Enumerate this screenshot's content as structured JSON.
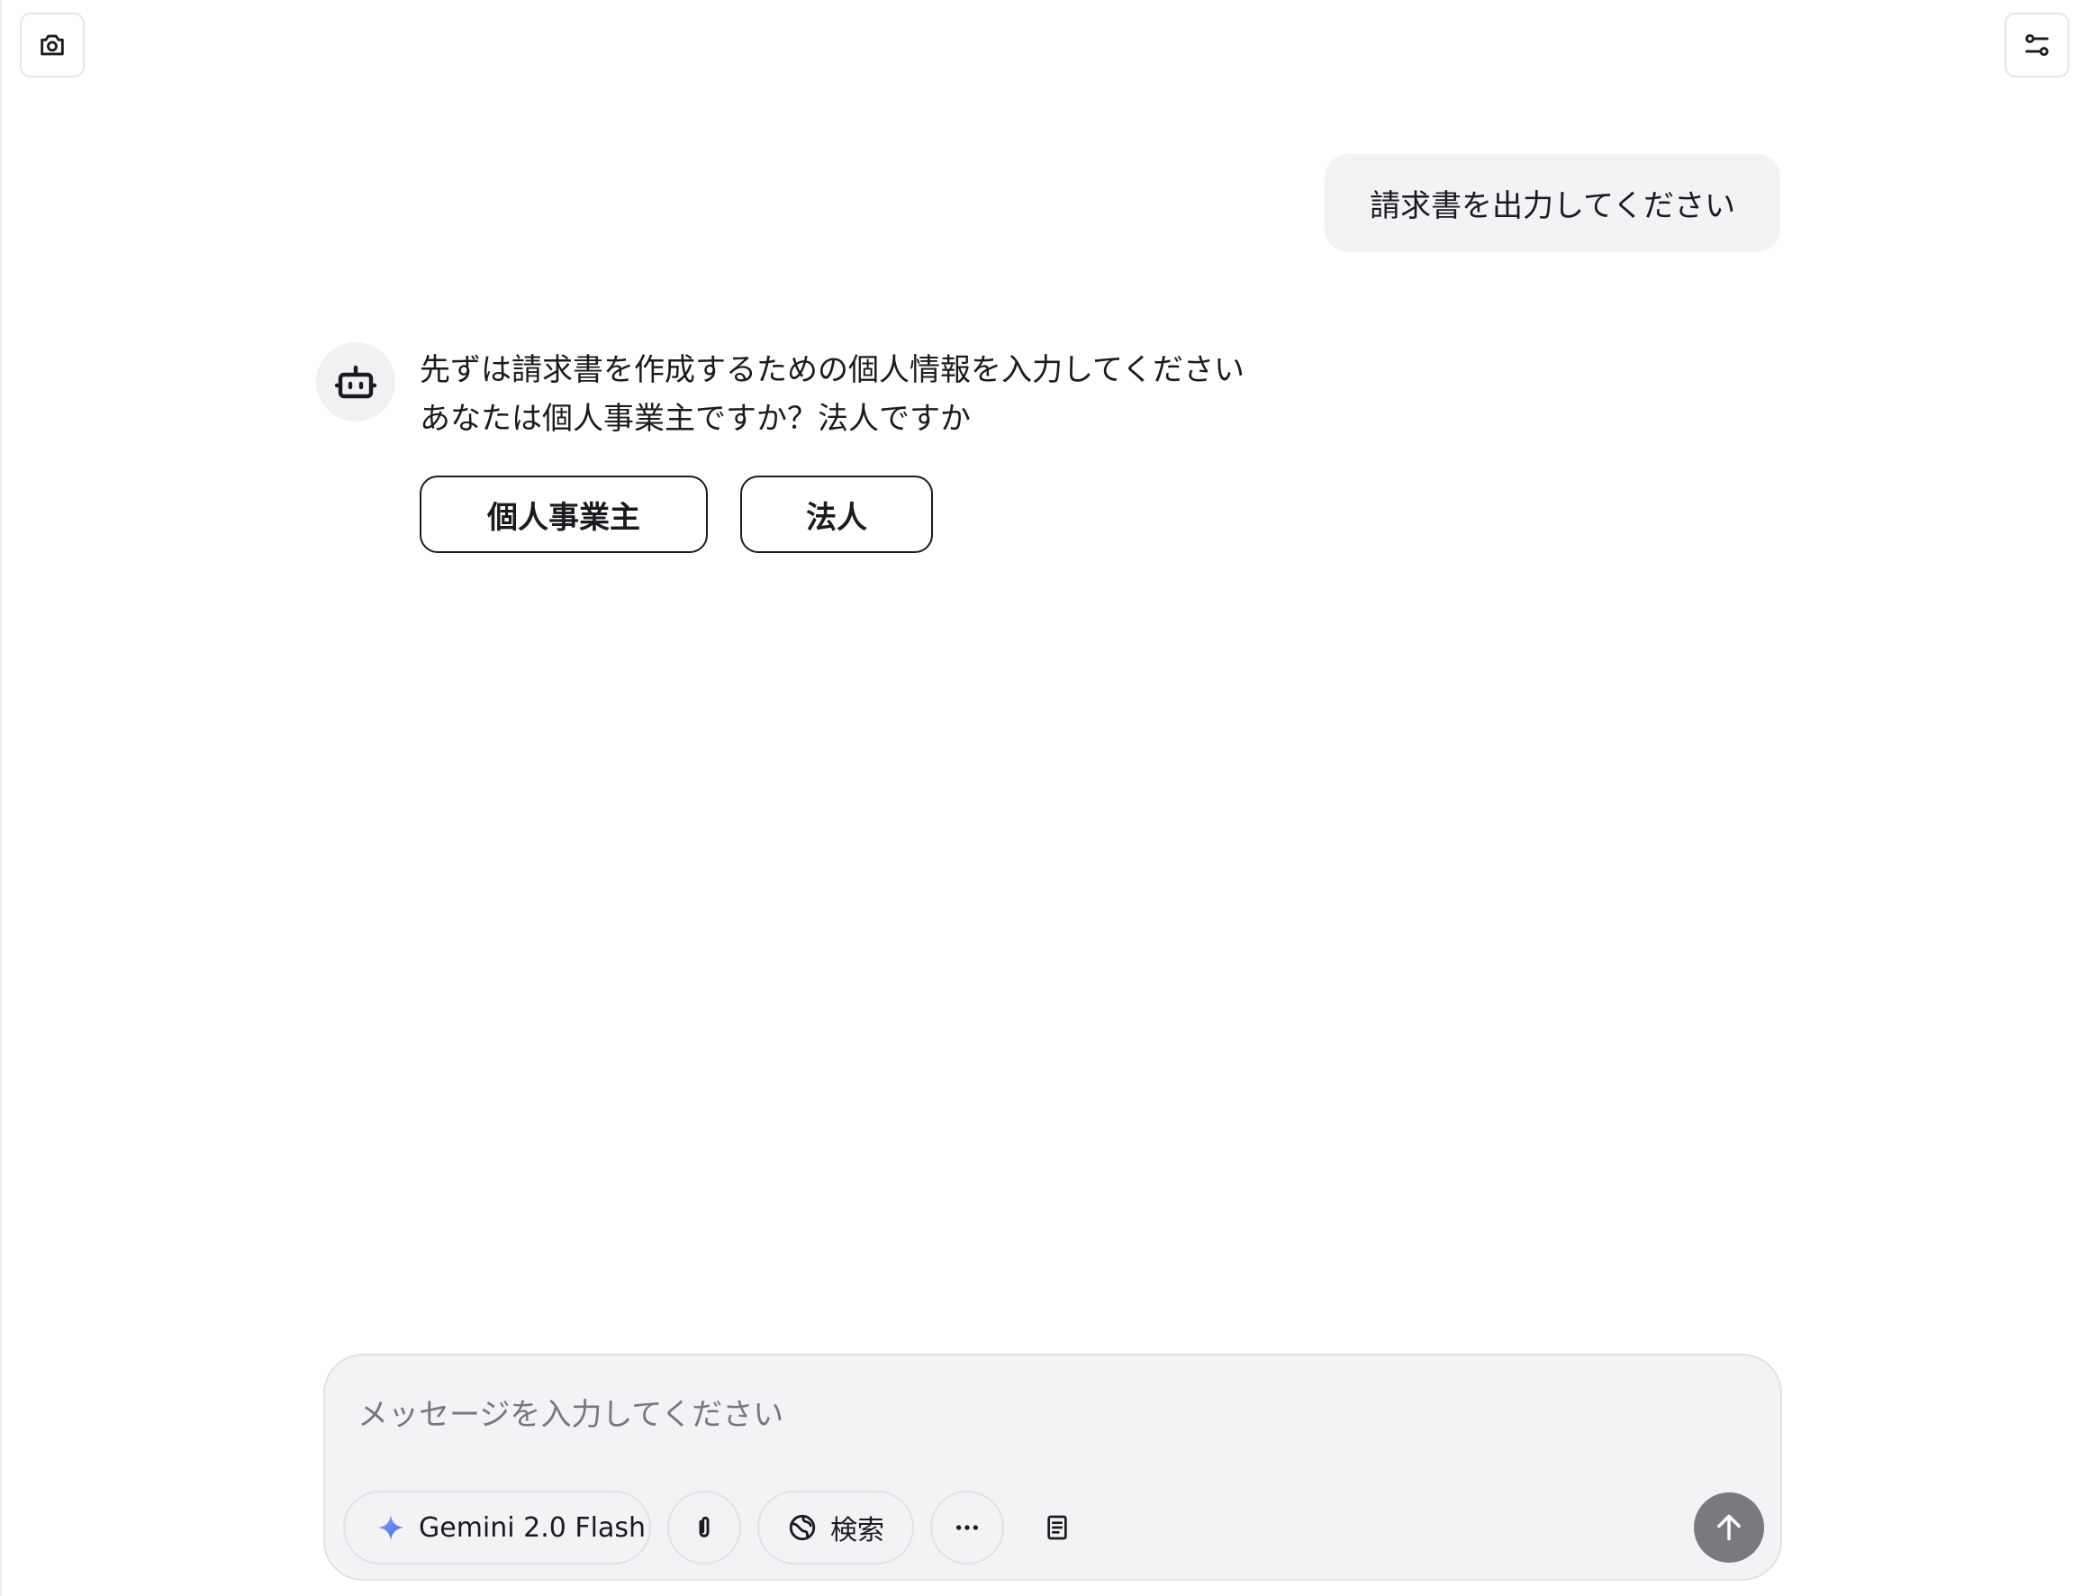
{
  "header": {
    "screenshot_icon": "camera-icon",
    "settings_icon": "sliders-icon"
  },
  "conversation": {
    "user_message": "請求書を出力してください",
    "bot_avatar_icon": "robot-icon",
    "bot_message_lines": [
      "先ずは請求書を作成するための個人情報を入力してください",
      "あなたは個人事業主ですか？法人ですか"
    ],
    "choices": [
      {
        "label": "個人事業主"
      },
      {
        "label": "法人"
      }
    ]
  },
  "composer": {
    "placeholder": "メッセージを入力してください",
    "model_label": "Gemini 2.0 Flash",
    "model_icon": "sparkle-icon",
    "attach_icon": "paperclip-icon",
    "search_label": "検索",
    "search_icon": "globe-icon",
    "more_icon": "ellipsis-icon",
    "notes_icon": "document-icon",
    "send_icon": "arrow-up-icon"
  },
  "colors": {
    "bubble_bg": "#f3f3f5",
    "send_button": "#7a7a7e",
    "sparkle_accent": "#4f7cf0"
  }
}
